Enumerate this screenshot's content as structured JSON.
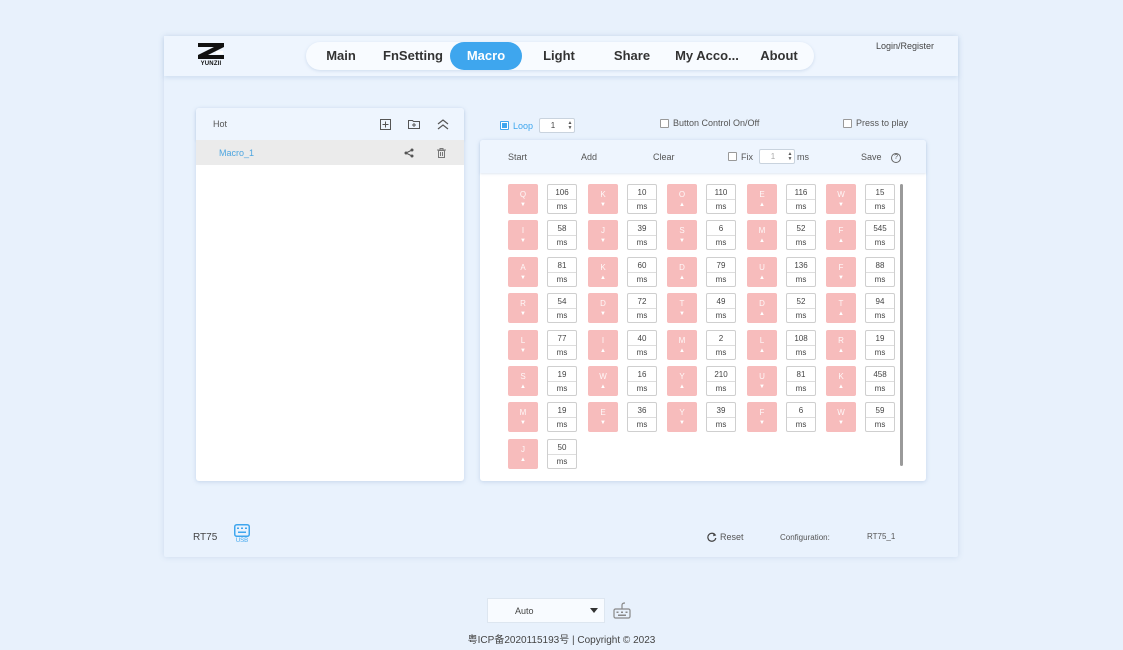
{
  "nav": {
    "items": [
      {
        "label": "Main",
        "active": false
      },
      {
        "label": "FnSetting",
        "active": false
      },
      {
        "label": "Macro",
        "active": true
      },
      {
        "label": "Light",
        "active": false
      },
      {
        "label": "Share",
        "active": false
      },
      {
        "label": "My Acco...",
        "active": false
      },
      {
        "label": "About",
        "active": false
      }
    ],
    "login": "Login/Register",
    "logo_text": "YUNZII"
  },
  "macro_list": {
    "title": "Hot",
    "items": [
      {
        "name": "Macro_1"
      }
    ]
  },
  "options": {
    "loop_label": "Loop",
    "loop_checked": true,
    "loop_count": "1",
    "button_control_label": "Button Control On/Off",
    "press_to_play_label": "Press to play"
  },
  "editor": {
    "start": "Start",
    "add": "Add",
    "clear": "Clear",
    "fix_label": "Fix",
    "fix_value": "1",
    "fix_unit": "ms",
    "save": "Save",
    "help": "?",
    "unit": "ms",
    "steps": [
      {
        "key": "Q",
        "dir": "▼",
        "delay": "106"
      },
      {
        "key": "K",
        "dir": "▼",
        "delay": "10"
      },
      {
        "key": "O",
        "dir": "▲",
        "delay": "110"
      },
      {
        "key": "E",
        "dir": "▲",
        "delay": "116"
      },
      {
        "key": "W",
        "dir": "▼",
        "delay": "15"
      },
      {
        "key": "I",
        "dir": "▼",
        "delay": "58"
      },
      {
        "key": "J",
        "dir": "▼",
        "delay": "39"
      },
      {
        "key": "S",
        "dir": "▼",
        "delay": "6"
      },
      {
        "key": "M",
        "dir": "▲",
        "delay": "52"
      },
      {
        "key": "F",
        "dir": "▲",
        "delay": "545"
      },
      {
        "key": "A",
        "dir": "▼",
        "delay": "81"
      },
      {
        "key": "K",
        "dir": "▲",
        "delay": "60"
      },
      {
        "key": "D",
        "dir": "▲",
        "delay": "79"
      },
      {
        "key": "U",
        "dir": "▲",
        "delay": "136"
      },
      {
        "key": "F",
        "dir": "▼",
        "delay": "88"
      },
      {
        "key": "R",
        "dir": "▼",
        "delay": "54"
      },
      {
        "key": "D",
        "dir": "▼",
        "delay": "72"
      },
      {
        "key": "T",
        "dir": "▼",
        "delay": "49"
      },
      {
        "key": "D",
        "dir": "▲",
        "delay": "52"
      },
      {
        "key": "T",
        "dir": "▲",
        "delay": "94"
      },
      {
        "key": "L",
        "dir": "▼",
        "delay": "77"
      },
      {
        "key": "I",
        "dir": "▲",
        "delay": "40"
      },
      {
        "key": "M",
        "dir": "▲",
        "delay": "2"
      },
      {
        "key": "L",
        "dir": "▲",
        "delay": "108"
      },
      {
        "key": "R",
        "dir": "▲",
        "delay": "19"
      },
      {
        "key": "S",
        "dir": "▲",
        "delay": "19"
      },
      {
        "key": "W",
        "dir": "▲",
        "delay": "16"
      },
      {
        "key": "Y",
        "dir": "▲",
        "delay": "210"
      },
      {
        "key": "U",
        "dir": "▼",
        "delay": "81"
      },
      {
        "key": "K",
        "dir": "▲",
        "delay": "458"
      },
      {
        "key": "M",
        "dir": "▼",
        "delay": "19"
      },
      {
        "key": "E",
        "dir": "▼",
        "delay": "36"
      },
      {
        "key": "Y",
        "dir": "▼",
        "delay": "39"
      },
      {
        "key": "F",
        "dir": "▼",
        "delay": "6"
      },
      {
        "key": "W",
        "dir": "▼",
        "delay": "59"
      },
      {
        "key": "J",
        "dir": "▲",
        "delay": "50"
      }
    ]
  },
  "footer": {
    "device": "RT75",
    "usb_label": "USB",
    "reset": "Reset",
    "configuration_label": "Configuration:",
    "configuration_value": "RT75_1"
  },
  "page_footer": {
    "mode": "Auto",
    "copyright": "粤ICP备2020115193号 | Copyright © 2023"
  },
  "colors": {
    "accent": "#3ea6ee",
    "key_bg": "#f7bcbc",
    "page_bg": "#e8f1fc"
  }
}
